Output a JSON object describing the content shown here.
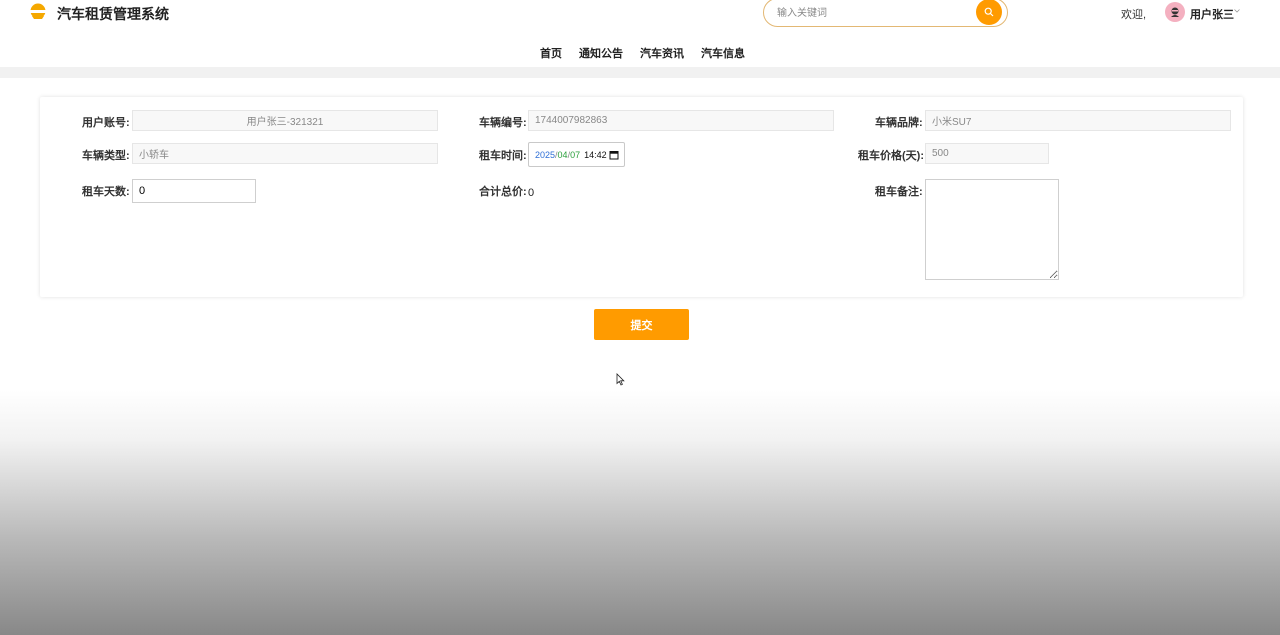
{
  "header": {
    "title": "汽车租赁管理系统",
    "search": {
      "placeholder": "输入关键词",
      "value": ""
    },
    "welcome": "欢迎,",
    "username": "用户张三"
  },
  "nav": {
    "items": [
      {
        "label": "首页"
      },
      {
        "label": "通知公告"
      },
      {
        "label": "汽车资讯"
      },
      {
        "label": "汽车信息"
      }
    ]
  },
  "form": {
    "account": {
      "label": "用户账号:",
      "value": "用户张三-321321"
    },
    "car_number": {
      "label": "车辆编号:",
      "value": "1744007982863"
    },
    "brand": {
      "label": "车辆品牌:",
      "value": "小米SU7"
    },
    "car_type": {
      "label": "车辆类型:",
      "value": "小轿车"
    },
    "rent_time": {
      "label": "租车时间:",
      "year": "2025",
      "month": "04",
      "day": "07",
      "time": "14:42",
      "sep": "/"
    },
    "price": {
      "label": "租车价格(天):",
      "value": "500"
    },
    "days": {
      "label": "租车天数:",
      "value": "0"
    },
    "total": {
      "label": "合计总价:",
      "value": "0"
    },
    "remark": {
      "label": "租车备注:",
      "value": ""
    }
  },
  "submit_label": "提交",
  "colors": {
    "accent": "#ff9b00",
    "search_border": "#e3b874"
  }
}
